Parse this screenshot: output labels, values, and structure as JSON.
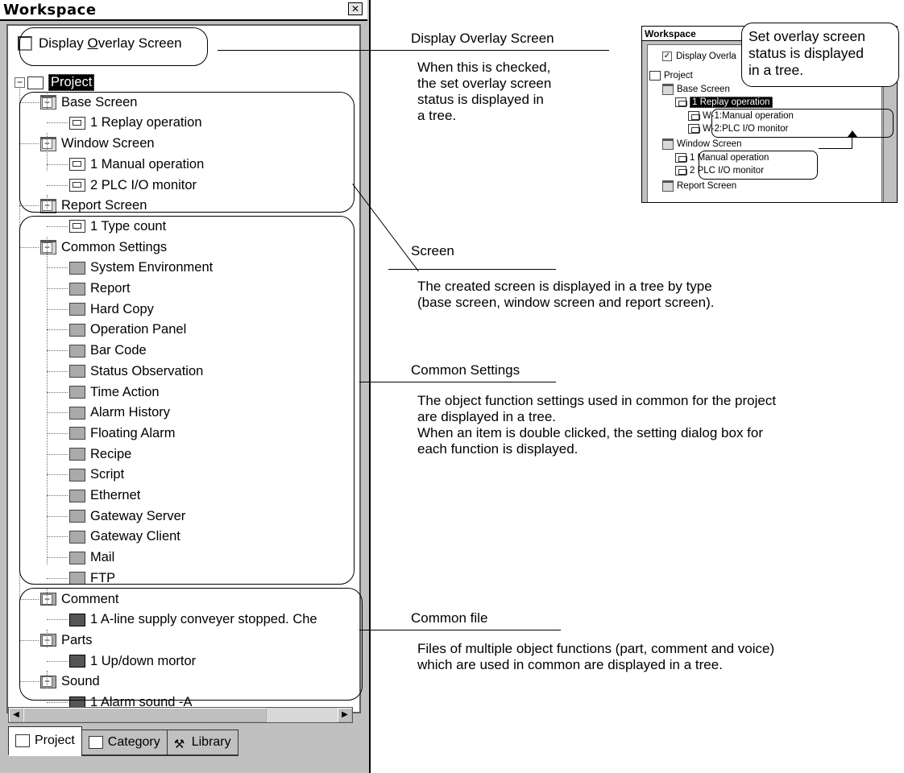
{
  "window": {
    "title": "Workspace",
    "close_glyph": "✕",
    "checkbox_label_before": "Display ",
    "checkbox_label_underlined": "O",
    "checkbox_label_after": "verlay Screen"
  },
  "tree": {
    "root": "Project",
    "items": [
      {
        "label": "Base Screen",
        "icon": "folder-icon"
      },
      {
        "label": "1 Replay operation",
        "icon": "screen-icon"
      },
      {
        "label": "Window Screen",
        "icon": "folder-icon"
      },
      {
        "label": "1 Manual operation",
        "icon": "screen-icon"
      },
      {
        "label": "2 PLC I/O monitor",
        "icon": "screen-icon"
      },
      {
        "label": "Report Screen",
        "icon": "folder-icon"
      },
      {
        "label": "1 Type count",
        "icon": "screen-icon"
      },
      {
        "label": "Common Settings",
        "icon": "folder-icon"
      },
      {
        "label": "System Environment",
        "icon": "system-environment-icon"
      },
      {
        "label": "Report",
        "icon": "report-icon"
      },
      {
        "label": "Hard Copy",
        "icon": "hard-copy-icon"
      },
      {
        "label": "Operation Panel",
        "icon": "operation-panel-icon"
      },
      {
        "label": "Bar Code",
        "icon": "bar-code-icon"
      },
      {
        "label": "Status Observation",
        "icon": "status-observation-icon"
      },
      {
        "label": "Time Action",
        "icon": "time-action-icon"
      },
      {
        "label": "Alarm History",
        "icon": "alarm-history-icon"
      },
      {
        "label": "Floating Alarm",
        "icon": "floating-alarm-icon"
      },
      {
        "label": "Recipe",
        "icon": "recipe-icon"
      },
      {
        "label": "Script",
        "icon": "script-icon"
      },
      {
        "label": "Ethernet",
        "icon": "ethernet-icon"
      },
      {
        "label": "Gateway Server",
        "icon": "gateway-server-icon"
      },
      {
        "label": "Gateway Client",
        "icon": "gateway-client-icon"
      },
      {
        "label": "Mail",
        "icon": "mail-icon"
      },
      {
        "label": "FTP",
        "icon": "ftp-icon"
      },
      {
        "label": "Comment",
        "icon": "comment-icon"
      },
      {
        "label": "1 A-line supply conveyer stopped. Che",
        "icon": "file-icon"
      },
      {
        "label": "Parts",
        "icon": "parts-icon"
      },
      {
        "label": "1 Up/down mortor",
        "icon": "file-icon"
      },
      {
        "label": "Sound",
        "icon": "sound-icon"
      },
      {
        "label": "1 Alarm sound -A",
        "icon": "file-icon"
      }
    ]
  },
  "scrollbar": {
    "left_glyph": "◀",
    "right_glyph": "▶"
  },
  "tabs": [
    {
      "label": "Project",
      "icon": "project-tab-icon"
    },
    {
      "label": "Category",
      "icon": "category-tab-icon"
    },
    {
      "label": "Library",
      "icon": "library-tab-icon"
    }
  ],
  "callouts": {
    "overlay": {
      "title": "Display Overlay Screen",
      "lines": [
        "When this is checked,",
        "the set overlay screen",
        "status is displayed in",
        "a tree."
      ]
    },
    "screen": {
      "title": "Screen",
      "lines": [
        "The created screen is displayed in a tree by type",
        "(base screen, window screen and report screen)."
      ]
    },
    "common_settings": {
      "title": "Common Settings",
      "lines": [
        "The object function settings used in common for the project",
        "are displayed in a tree.",
        "When an item is double clicked, the setting dialog box for",
        "each function is displayed."
      ]
    },
    "common_file": {
      "title": "Common file",
      "lines": [
        "Files of multiple object functions (part, comment and voice)",
        "which are used in common are displayed in a tree."
      ]
    }
  },
  "mini": {
    "title": "Workspace",
    "checkbox_label": "Display Overla",
    "callout_lines": [
      "Set overlay screen",
      "status is displayed",
      "in a tree."
    ],
    "items": [
      "Project",
      "Base Screen",
      "1 Replay operation",
      "W-1:Manual operation",
      "W-2:PLC I/O monitor",
      "Window Screen",
      "1 Manual operation",
      "2 PLC I/O monitor",
      "Report Screen"
    ]
  }
}
